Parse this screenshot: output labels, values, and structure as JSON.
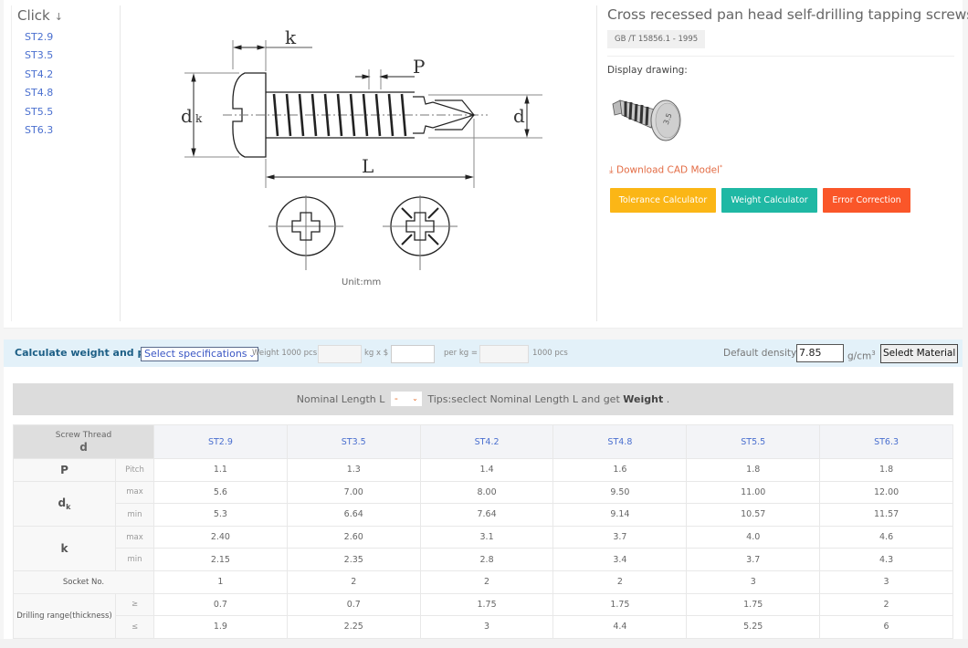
{
  "sidebar": {
    "title": "Click",
    "arrow_icon": "arrow-down-icon",
    "items": [
      "ST2.9",
      "ST3.5",
      "ST4.2",
      "ST4.8",
      "ST5.5",
      "ST6.3"
    ]
  },
  "drawing": {
    "labels": {
      "k": "k",
      "p": "P",
      "dk": "d",
      "dk_sub": "k",
      "d": "d",
      "l": "L"
    },
    "unit": "Unit:mm"
  },
  "product": {
    "title": "Cross recessed pan head self-drilling tapping screws",
    "standard": "GB /T 15856.1 - 1995",
    "display_label": "Display drawing:",
    "cad_link": "Download CAD Model",
    "cad_mark": "*",
    "buttons": {
      "tolerance": "Tolerance Calculator",
      "weight": "Weight Calculator",
      "error": "Error Correction"
    },
    "colors": {
      "tolerance": "#fbb616",
      "weight": "#1fb8a4",
      "error": "#fa5629",
      "link": "#e36c45"
    }
  },
  "calc": {
    "title": "Calculate weight and price.",
    "spec_select": "Select specifications",
    "weight_label": "Weight 1000 pcs :",
    "weight_value": "",
    "kg_label": "kg x $",
    "price_value": "",
    "per_kg_label": "per kg = $",
    "total_value": "",
    "pcs_label": "1000 pcs",
    "density_label": "Default density",
    "density_value": "7.85",
    "density_unit": "g/cm",
    "density_unit_sup": "3",
    "material_button": "Seledt Material"
  },
  "length": {
    "label": "Nominal Length L",
    "selected": "-",
    "tip_prefix": "Tips:seclect Nominal Length L and get",
    "tip_bold": "Weight",
    "tip_suffix": "."
  },
  "table": {
    "corner_line1": "Screw Thread",
    "corner_line2": "d",
    "columns": [
      "ST2.9",
      "ST3.5",
      "ST4.2",
      "ST4.8",
      "ST5.5",
      "ST6.3"
    ],
    "rows": [
      {
        "group": "P",
        "sub": "Pitch",
        "values": [
          "1.1",
          "1.3",
          "1.4",
          "1.6",
          "1.8",
          "1.8"
        ]
      },
      {
        "group": "dk",
        "sub": "max",
        "values": [
          "5.6",
          "7.00",
          "8.00",
          "9.50",
          "11.00",
          "12.00"
        ]
      },
      {
        "group": "dk",
        "sub": "min",
        "values": [
          "5.3",
          "6.64",
          "7.64",
          "9.14",
          "10.57",
          "11.57"
        ]
      },
      {
        "group": "k",
        "sub": "max",
        "values": [
          "2.40",
          "2.60",
          "3.1",
          "3.7",
          "4.0",
          "4.6"
        ]
      },
      {
        "group": "k",
        "sub": "min",
        "values": [
          "2.15",
          "2.35",
          "2.8",
          "3.4",
          "3.7",
          "4.3"
        ]
      },
      {
        "group": "Socket No.",
        "sub": "",
        "values": [
          "1",
          "2",
          "2",
          "2",
          "3",
          "3"
        ]
      },
      {
        "group": "Drilling range(thickness)",
        "sub": "≥",
        "values": [
          "0.7",
          "0.7",
          "1.75",
          "1.75",
          "1.75",
          "2"
        ]
      },
      {
        "group": "Drilling range(thickness)",
        "sub": "≤",
        "values": [
          "1.9",
          "2.25",
          "3",
          "4.4",
          "5.25",
          "6"
        ]
      }
    ],
    "labels": {
      "p": "P",
      "dk_main": "d",
      "dk_sub": "k",
      "k": "k",
      "socket": "Socket No.",
      "drill": "Drilling range(thickness)"
    }
  }
}
